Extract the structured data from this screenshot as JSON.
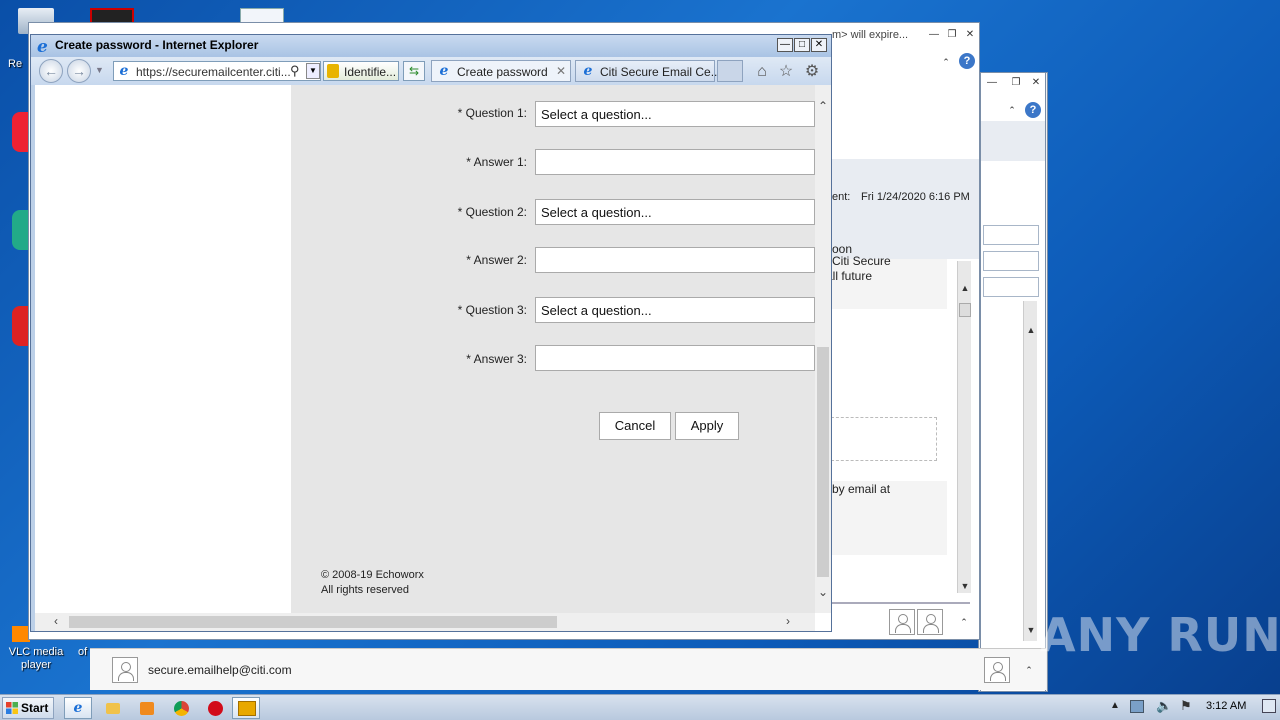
{
  "desktop": {
    "vlc_label": "VLC media player",
    "of_label": "of",
    "re_label": "Re"
  },
  "outlook": {
    "title_fragment": "m> will expire...",
    "sent_label": "ent:",
    "sent_value": "Fri 1/24/2020 6:16 PM",
    "body_line1": "oon",
    "body_line2": "i Citi Secure",
    "body_line3": "all future",
    "body_line4": "by email at",
    "contact_email": "secure.emailhelp@citi.com"
  },
  "ie": {
    "title": "Create password - Internet Explorer",
    "address": "https://securemailcenter.citi...",
    "identified": "Identifie...",
    "tabs": [
      {
        "label": "Create password",
        "active": true
      },
      {
        "label": "Citi Secure Email Ce...",
        "active": false
      }
    ]
  },
  "form": {
    "question1_label": "* Question 1:",
    "question1_value": "Select a question...",
    "answer1_label": "* Answer 1:",
    "question2_label": "* Question 2:",
    "question2_value": "Select a question...",
    "answer2_label": "* Answer 2:",
    "question3_label": "* Question 3:",
    "question3_value": "Select a question...",
    "answer3_label": "* Answer 3:",
    "cancel_label": "Cancel",
    "apply_label": "Apply",
    "copyright_line1": "© 2008-19 Echoworx",
    "copyright_line2": "All rights reserved"
  },
  "watermark": "ANY RUN",
  "taskbar": {
    "start_label": "Start",
    "clock": "3:12 AM"
  }
}
